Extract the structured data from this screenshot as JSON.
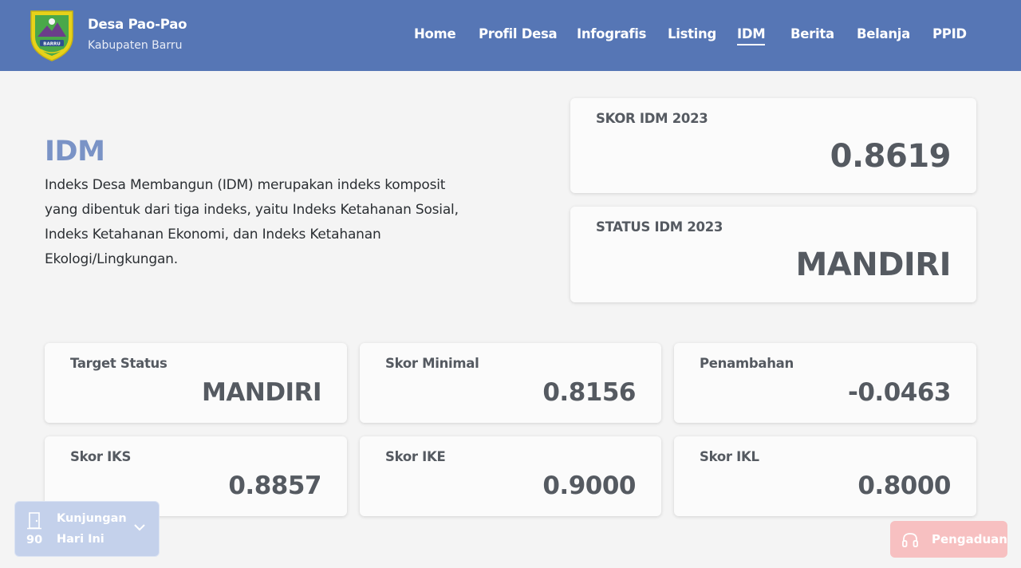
{
  "header": {
    "logo_text": "BARRU",
    "village_name": "Desa Pao-Pao",
    "regency": "Kabupaten Barru",
    "nav": [
      {
        "label": "Home"
      },
      {
        "label": "Profil Desa"
      },
      {
        "label": "Infografis"
      },
      {
        "label": "Listing"
      },
      {
        "label": "IDM",
        "active": true
      },
      {
        "label": "Berita"
      },
      {
        "label": "Belanja"
      },
      {
        "label": "PPID"
      }
    ]
  },
  "intro": {
    "title": "IDM",
    "description": "Indeks Desa Membangun (IDM) merupakan indeks komposit yang dibentuk dari tiga indeks, yaitu Indeks Ketahanan Sosial, Indeks Ketahanan Ekonomi, dan Indeks Ketahanan Ekologi/Lingkungan."
  },
  "summary": {
    "score": {
      "label": "SKOR IDM 2023",
      "value": "0.8619"
    },
    "status": {
      "label": "STATUS IDM 2023",
      "value": "MANDIRI"
    }
  },
  "stats": [
    {
      "label": "Target Status",
      "value": "MANDIRI"
    },
    {
      "label": "Skor Minimal",
      "value": "0.8156"
    },
    {
      "label": "Penambahan",
      "value": "-0.0463"
    },
    {
      "label": "Skor IKS",
      "value": "0.8857"
    },
    {
      "label": "Skor IKE",
      "value": "0.9000"
    },
    {
      "label": "Skor IKL",
      "value": "0.8000"
    }
  ],
  "visits": {
    "count": "90",
    "line1": "Kunjungan",
    "line2": "Hari Ini"
  },
  "complaint": {
    "label": "Pengaduan"
  },
  "colors": {
    "navbar": "#5676b5",
    "title_accent": "#7a93c6",
    "visit_widget": "#c4d1eb",
    "complaint_button": "#f7c0c1",
    "logo_shield": "#e7d21a",
    "logo_inner": "#4aa84a"
  }
}
